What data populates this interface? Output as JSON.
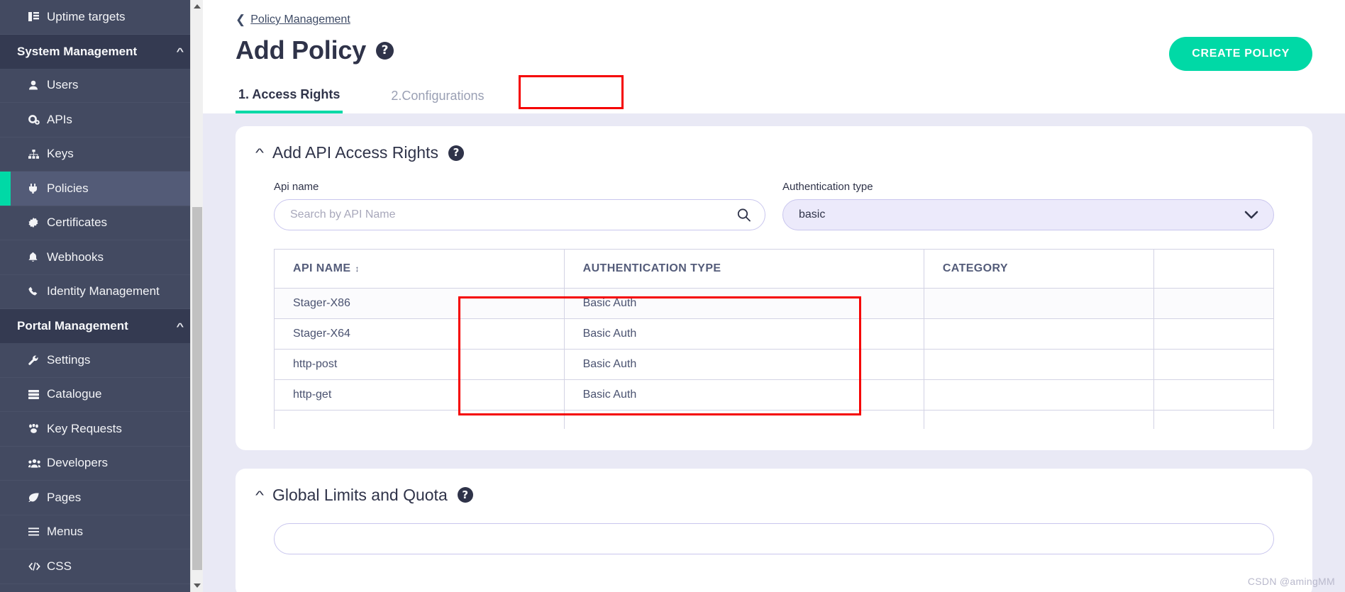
{
  "sidebar": {
    "items": [
      {
        "label": "Uptime targets",
        "icon": "list-table-icon",
        "type": "link",
        "active": false
      },
      {
        "label": "System Management",
        "icon": "chevron-up-icon",
        "type": "group"
      },
      {
        "label": "Users",
        "icon": "user-icon",
        "type": "link",
        "active": false
      },
      {
        "label": "APIs",
        "icon": "gears-icon",
        "type": "link",
        "active": false
      },
      {
        "label": "Keys",
        "icon": "sitemap-icon",
        "type": "link",
        "active": false
      },
      {
        "label": "Policies",
        "icon": "plug-icon",
        "type": "link",
        "active": true
      },
      {
        "label": "Certificates",
        "icon": "certificate-icon",
        "type": "link",
        "active": false
      },
      {
        "label": "Webhooks",
        "icon": "bell-icon",
        "type": "link",
        "active": false
      },
      {
        "label": "Identity Management",
        "icon": "phone-icon",
        "type": "link",
        "active": false
      },
      {
        "label": "Portal Management",
        "icon": "chevron-up-icon",
        "type": "group"
      },
      {
        "label": "Settings",
        "icon": "wrench-icon",
        "type": "link",
        "active": false
      },
      {
        "label": "Catalogue",
        "icon": "server-icon",
        "type": "link",
        "active": false
      },
      {
        "label": "Key Requests",
        "icon": "paw-icon",
        "type": "link",
        "active": false
      },
      {
        "label": "Developers",
        "icon": "users-icon",
        "type": "link",
        "active": false
      },
      {
        "label": "Pages",
        "icon": "leaf-icon",
        "type": "link",
        "active": false
      },
      {
        "label": "Menus",
        "icon": "bars-icon",
        "type": "link",
        "active": false
      },
      {
        "label": "CSS",
        "icon": "code-icon",
        "type": "link",
        "active": false
      }
    ]
  },
  "header": {
    "breadcrumb": "Policy Management",
    "title": "Add Policy",
    "help": "?",
    "create_button": "CREATE POLICY",
    "tabs": [
      {
        "label": "1. Access Rights",
        "active": true
      },
      {
        "label": "2.Configurations",
        "active": false
      }
    ]
  },
  "access_rights": {
    "section_title": "Add API Access Rights",
    "help": "?",
    "api_name": {
      "label": "Api name",
      "placeholder": "Search by API Name",
      "value": "",
      "icon": "search-icon"
    },
    "auth_type": {
      "label": "Authentication type",
      "value": "basic",
      "icon": "chevron-down-icon",
      "options": [
        "basic"
      ]
    },
    "table": {
      "columns": [
        "API NAME",
        "AUTHENTICATION TYPE",
        "CATEGORY",
        ""
      ],
      "sort_icon": "sort-icon",
      "rows": [
        {
          "api_name": "Stager-X86",
          "auth_type": "Basic Auth",
          "category": "",
          "extra": ""
        },
        {
          "api_name": "Stager-X64",
          "auth_type": "Basic Auth",
          "category": "",
          "extra": ""
        },
        {
          "api_name": "http-post",
          "auth_type": "Basic Auth",
          "category": "",
          "extra": ""
        },
        {
          "api_name": "http-get",
          "auth_type": "Basic Auth",
          "category": "",
          "extra": ""
        }
      ]
    }
  },
  "global_limits": {
    "section_title": "Global Limits and Quota",
    "help": "?"
  },
  "watermark": "CSDN @amingMM",
  "colors": {
    "accent": "#00d9a6",
    "sidebar_bg": "#434a61",
    "sidebar_group_bg": "#343a51",
    "sidebar_active_bg": "#535b77",
    "page_bg": "#e9e9f5",
    "annotation": "#f50000",
    "text_dark": "#2f3349"
  }
}
